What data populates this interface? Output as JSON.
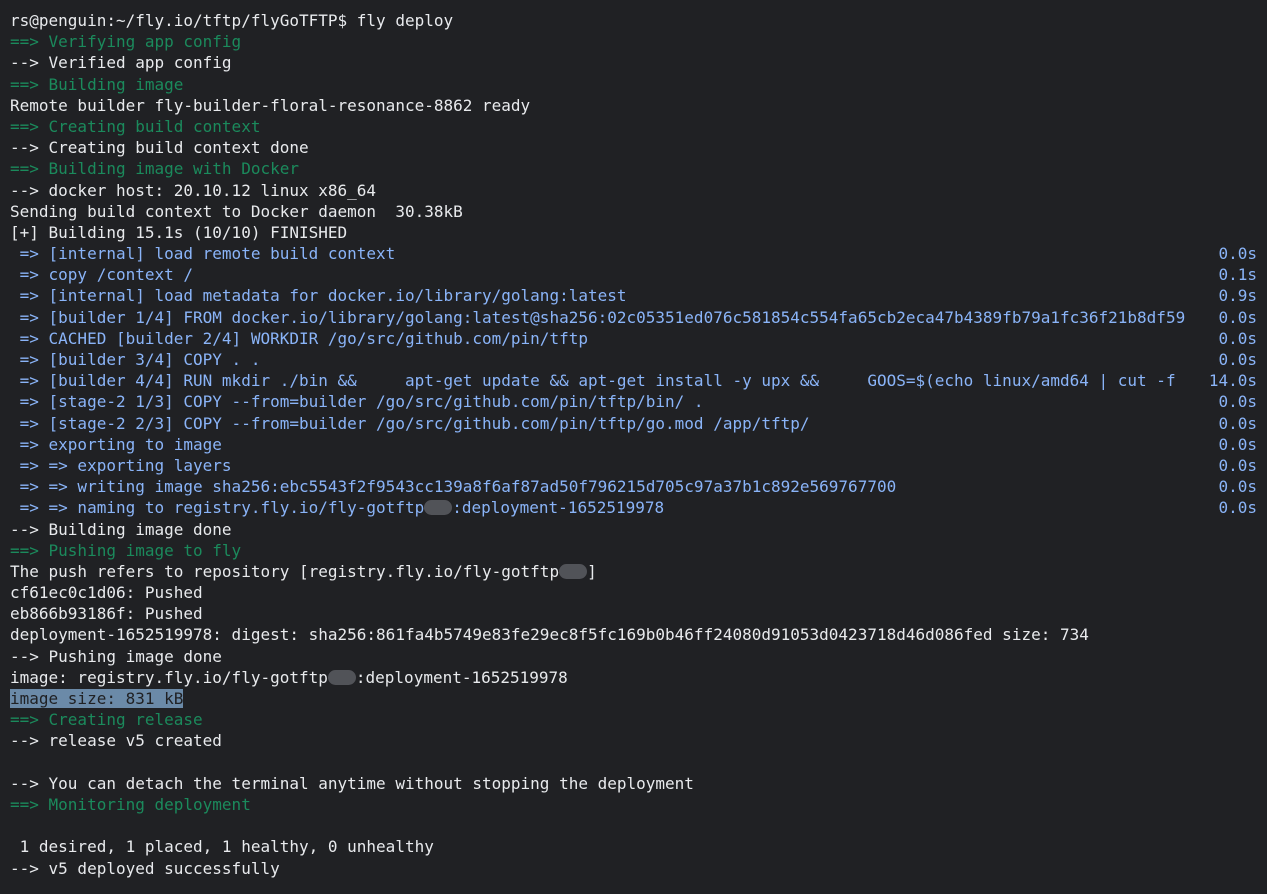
{
  "terminal": {
    "prompt": "rs@penguin:~/fly.io/tftp/flyGoTFTP$ fly deploy",
    "lines_top": [
      {
        "text": "==> Verifying app config",
        "color": "green"
      },
      {
        "text": "--> Verified app config",
        "color": "default"
      },
      {
        "text": "==> Building image",
        "color": "green"
      },
      {
        "text": "Remote builder fly-builder-floral-resonance-8862 ready",
        "color": "default"
      },
      {
        "text": "==> Creating build context",
        "color": "green"
      },
      {
        "text": "--> Creating build context done",
        "color": "default"
      },
      {
        "text": "==> Building image with Docker",
        "color": "green"
      },
      {
        "text": "--> docker host: 20.10.12 linux x86_64",
        "color": "default"
      },
      {
        "text": "Sending build context to Docker daemon  30.38kB",
        "color": "default"
      },
      {
        "text": "[+] Building 15.1s (10/10) FINISHED",
        "color": "default"
      }
    ],
    "build_steps": [
      {
        "text": " => [internal] load remote build context",
        "time": "0.0s"
      },
      {
        "text": " => copy /context /",
        "time": "0.1s"
      },
      {
        "text": " => [internal] load metadata for docker.io/library/golang:latest",
        "time": "0.9s"
      },
      {
        "text": " => [builder 1/4] FROM docker.io/library/golang:latest@sha256:02c05351ed076c581854c554fa65cb2eca47b4389fb79a1fc36f21b8df59",
        "time": "0.0s"
      },
      {
        "text": " => CACHED [builder 2/4] WORKDIR /go/src/github.com/pin/tftp",
        "time": "0.0s"
      },
      {
        "text": " => [builder 3/4] COPY . .",
        "time": "0.0s"
      },
      {
        "text": " => [builder 4/4] RUN mkdir ./bin &&     apt-get update && apt-get install -y upx &&     GOOS=$(echo linux/amd64 | cut -f",
        "time": "14.0s"
      },
      {
        "text": " => [stage-2 1/3] COPY --from=builder /go/src/github.com/pin/tftp/bin/ .",
        "time": "0.0s"
      },
      {
        "text": " => [stage-2 2/3] COPY --from=builder /go/src/github.com/pin/tftp/go.mod /app/tftp/",
        "time": "0.0s"
      },
      {
        "text": " => exporting to image",
        "time": "0.0s"
      },
      {
        "text": " => => exporting layers",
        "time": "0.0s"
      },
      {
        "text": " => => writing image sha256:ebc5543f2f9543cc139a8f6af87ad50f796215d705c97a37b1c892e569767700",
        "time": "0.0s"
      }
    ],
    "naming_step": {
      "prefix": " => => naming to registry.fly.io/fly-gotftp",
      "suffix": ":deployment-1652519978",
      "time": "0.0s"
    },
    "lines_mid": [
      {
        "text": "--> Building image done",
        "color": "default"
      },
      {
        "text": "==> Pushing image to fly",
        "color": "green"
      }
    ],
    "push_ref": {
      "prefix": "The push refers to repository [registry.fly.io/fly-gotftp",
      "suffix": "]"
    },
    "lines_push": [
      {
        "text": "cf61ec0c1d06: Pushed",
        "color": "default"
      },
      {
        "text": "eb866b93186f: Pushed",
        "color": "default"
      },
      {
        "text": "deployment-1652519978: digest: sha256:861fa4b5749e83fe29ec8f5fc169b0b46ff24080d91053d0423718d46d086fed size: 734",
        "color": "default"
      },
      {
        "text": "--> Pushing image done",
        "color": "default"
      }
    ],
    "image_line": {
      "prefix": "image: registry.fly.io/fly-gotftp",
      "suffix": ":deployment-1652519978"
    },
    "image_size": "image size: 831 kB",
    "lines_bottom": [
      {
        "text": "==> Creating release",
        "color": "green"
      },
      {
        "text": "--> release v5 created",
        "color": "default"
      },
      {
        "text": "",
        "color": "default"
      },
      {
        "text": "--> You can detach the terminal anytime without stopping the deployment",
        "color": "default"
      },
      {
        "text": "==> Monitoring deployment",
        "color": "green"
      },
      {
        "text": "",
        "color": "default"
      },
      {
        "text": " 1 desired, 1 placed, 1 healthy, 0 unhealthy",
        "color": "default"
      },
      {
        "text": "--> v5 deployed successfully",
        "color": "default"
      }
    ],
    "colors": {
      "background": "#202124",
      "default": "#e8eaed",
      "green": "#1b8a5c",
      "blue": "#8ab4f8",
      "highlight": "#6b8aa8"
    }
  }
}
